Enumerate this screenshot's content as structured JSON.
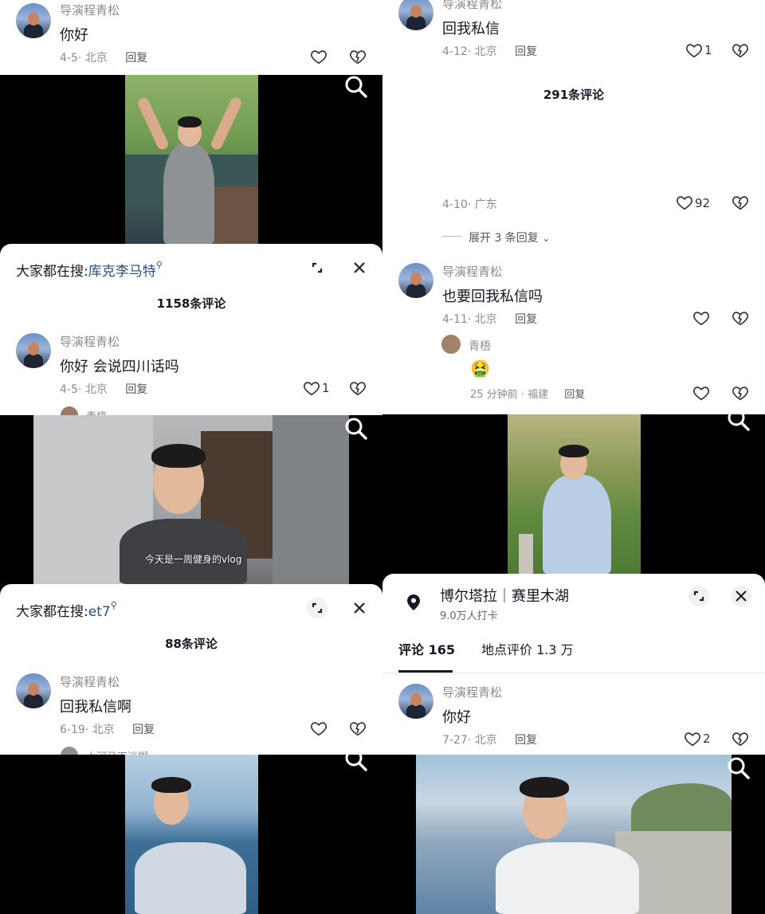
{
  "panels": {
    "p1_top_comment": {
      "name": "导演程青松",
      "text": "你好",
      "meta": "4-5· 北京",
      "reply": "回复"
    },
    "p2_sheet": {
      "search_prefix": "大家都在搜:",
      "search_keyword": "库克李马特",
      "count_title": "1158条评论",
      "comment": {
        "name": "导演程青松",
        "text": "你好 会说四川话吗",
        "meta": "4-5· 北京",
        "reply": "回复",
        "likes": "1"
      },
      "partial_name": "青梧"
    },
    "p3_top_comment": {
      "name": "导演程青松",
      "text": "回我私信",
      "meta": "4-12· 北京",
      "reply": "回复",
      "likes": "1",
      "count_title": "291条评论"
    },
    "p4_comment_tail": {
      "meta": "4-10· 广东",
      "likes": "92",
      "expand": "展开 3 条回复"
    },
    "p5_comment": {
      "name": "导演程青松",
      "text": "也要回我私信吗",
      "meta": "4-11· 北京",
      "reply": "回复",
      "sub_name": "青梧",
      "sub_emoji": "🤮",
      "sub_meta": "25 分钟前 · 福建",
      "sub_reply": "回复"
    },
    "p6_sheet": {
      "search_prefix": "大家都在搜:",
      "search_keyword": "et7",
      "count_title": "88条评论",
      "comment": {
        "name": "导演程青松",
        "text": "回我私信啊",
        "meta": "6-19· 北京",
        "reply": "回复"
      },
      "partial_name": "小河马不迷糊"
    },
    "p7_location": {
      "title": "博尔塔拉｜赛里木湖",
      "subtitle": "9.0万人打卡",
      "tab_comments": "评论 165",
      "tab_reviews": "地点评价 1.3 万",
      "comment": {
        "name": "导演程青松",
        "text": "你好",
        "meta": "7-27· 北京",
        "reply": "回复",
        "likes": "2"
      }
    },
    "video_captions": {
      "v3": "今天是一周健身的vlog"
    }
  },
  "colors": {
    "text_primary": "#161823",
    "text_secondary": "#8a8b91",
    "keyword": "#2a4f86",
    "background": "#000000",
    "sheet": "#ffffff"
  },
  "icons": [
    "search-icon",
    "heart-icon",
    "dislike-icon",
    "expand-icon",
    "close-icon",
    "location-pin-icon",
    "chevron-down-icon"
  ]
}
